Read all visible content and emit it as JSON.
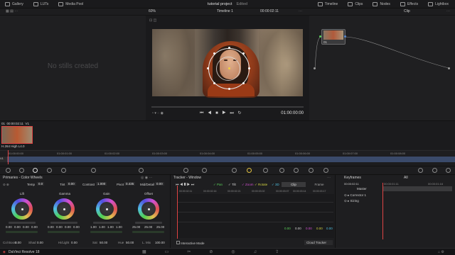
{
  "topbar": {
    "left": [
      "Gallery",
      "LUTs",
      "Media Pool"
    ],
    "title": "tutorial project",
    "edited": "Edited",
    "right": [
      "Timeline",
      "Clips",
      "Nodes",
      "Effects",
      "Lightbox"
    ]
  },
  "row2": {
    "zoom": "60%",
    "timeline": "Timeline 1",
    "timecode": "00:00:02:11",
    "clip": "Clip"
  },
  "gallery": {
    "empty": "No stills created"
  },
  "viewer": {
    "timecode": "01:00:00:00"
  },
  "node": {
    "label": "01"
  },
  "clipstrip": {
    "num": "01",
    "tc": "00:00:02:11",
    "track": "V1",
    "codec": "H.264 High L4.0"
  },
  "ruler": [
    "01:00:00:00",
    "01:00:01:00",
    "01:00:02:00",
    "01:00:03:00",
    "01:00:04:00",
    "01:00:05:00",
    "01:00:06:00",
    "01:00:07:00",
    "01:00:08:00"
  ],
  "track": {
    "label": "V1"
  },
  "cw": {
    "title": "Primaries - Color Wheels",
    "temp_label": "Temp",
    "temp": "0.0",
    "tint_label": "Tint",
    "tint": "0.00",
    "contrast_label": "Contrast",
    "contrast": "1.000",
    "pivot_label": "Pivot",
    "pivot": "0.435",
    "middetail_label": "Mid/Detail",
    "middetail": "0.00",
    "wheels": [
      {
        "name": "Lift",
        "vals": [
          "0.00",
          "0.00",
          "0.00",
          "0.00"
        ]
      },
      {
        "name": "Gamma",
        "vals": [
          "0.00",
          "0.00",
          "0.00",
          "0.00"
        ]
      },
      {
        "name": "Gain",
        "vals": [
          "1.00",
          "1.00",
          "1.00",
          "1.00"
        ]
      },
      {
        "name": "Offset",
        "vals": [
          "25.00",
          "25.00",
          "25.00"
        ]
      }
    ],
    "bottom": [
      {
        "l": "Col Boost",
        "v": "0.00"
      },
      {
        "l": "Shad",
        "v": "0.00"
      },
      {
        "l": "Hi/Light",
        "v": "0.00"
      },
      {
        "l": "Sat",
        "v": "50.00"
      },
      {
        "l": "Hue",
        "v": "50.00"
      },
      {
        "l": "L. Mix",
        "v": "100.00"
      }
    ]
  },
  "tracker": {
    "title": "Tracker - Window",
    "pan": "Pan",
    "tilt": "Tilt",
    "zoom": "Zoom",
    "rotate": "Rotate",
    "d3": "3D",
    "clip": "Clip",
    "frame": "Frame",
    "ticks": [
      "00:00:02:11",
      "00:00:02:16",
      "00:00:02:21",
      "00:00:03:02",
      "00:00:03:07",
      "00:00:03:14",
      "00:00:03:17"
    ],
    "values": [
      "0.00",
      "0.00",
      "0.00",
      "0.00",
      "0.00"
    ],
    "interactive": "Interactive Mode",
    "cloud": "Cloud Tracker"
  },
  "keyframes": {
    "title": "Keyframes",
    "all": "All",
    "tc1": "00:00:02:11",
    "tc2": "00:00:01:11",
    "tc3": "00:00:01:16",
    "master": "Master",
    "rows": [
      "Corrector 1",
      "Sizing"
    ]
  },
  "status": {
    "app": "DaVinci Resolve 18"
  }
}
